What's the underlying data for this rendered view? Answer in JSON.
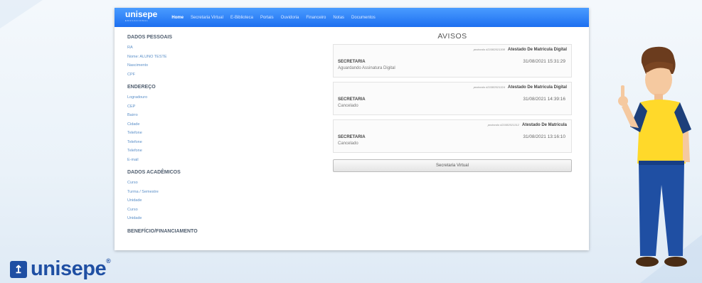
{
  "nav": {
    "brand": "unisepe",
    "brand_sub": "EDUCACIONAL",
    "items": [
      "Home",
      "Secretaria Virtual",
      "E-Biblioteca",
      "Portais",
      "Ouvidoria",
      "Financeiro",
      "Notas",
      "Documentos"
    ]
  },
  "dados_pessoais": {
    "title": "DADOS PESSOAIS",
    "fields": [
      "RA",
      "Nome: ALUNO TESTE",
      "Nascimento",
      "CPF"
    ]
  },
  "endereco": {
    "title": "ENDEREÇO",
    "fields": [
      "Logradouro",
      "CEP",
      "Bairro",
      "Cidade",
      "Telefone",
      "Telefone",
      "Telefone",
      "E-mail"
    ]
  },
  "dados_academicos": {
    "title": "DADOS ACADÊMICOS",
    "fields": [
      "Curso",
      "Turma / Semestre",
      "Unidade",
      "Curso",
      "Unidade"
    ]
  },
  "beneficio": {
    "title": "BENEFÍCIO/FINANCIAMENTO"
  },
  "avisos": {
    "title": "AVISOS",
    "items": [
      {
        "protocol": "protocolo #21082021308",
        "subject": "Atestado De Matricula Digital",
        "origin": "SECRETARIA",
        "status": "Aguardando Assinatura Digital",
        "date": "31/08/2021 15:31:29"
      },
      {
        "protocol": "protocolo #21082021324",
        "subject": "Atestado De Matricula Digital",
        "origin": "SECRETARIA",
        "status": "Cancelado",
        "date": "31/08/2021 14:39:16"
      },
      {
        "protocol": "protocolo #21082021312",
        "subject": "Atestado De Matricula",
        "origin": "SECRETARIA",
        "status": "Cancelado",
        "date": "31/08/2021 13:16:10"
      }
    ],
    "button_label": "Secretaria Virtual"
  },
  "footer_logo": {
    "text": "unisepe",
    "reg": "®"
  },
  "colors": {
    "nav_blue": "#1d6ff0",
    "logo_blue": "#1f4fa3",
    "field_blue": "#5b8fc8"
  }
}
